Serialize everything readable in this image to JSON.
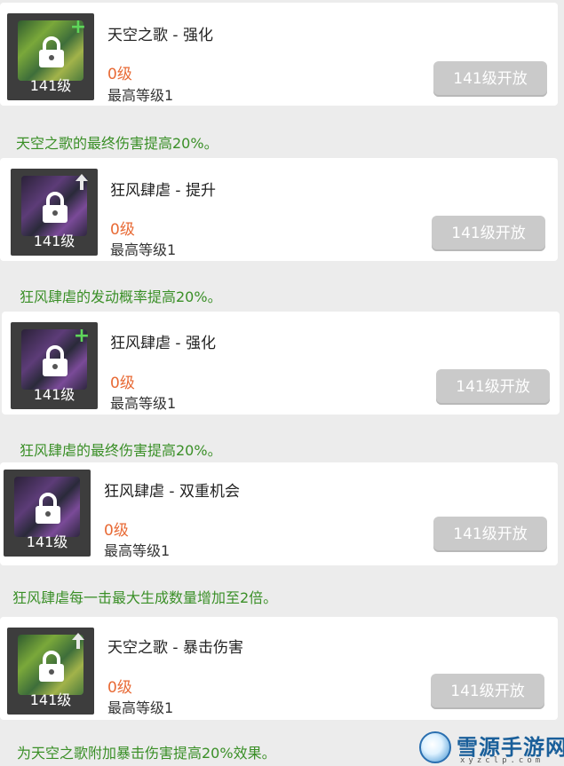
{
  "skills": [
    {
      "title": "天空之歌 - 强化",
      "icon_level": "141级",
      "current_level": "0级",
      "max_level": "最高等级1",
      "button_label": "141级开放",
      "description": "天空之歌的最终伤害提高20%。",
      "icon_badge": "plus-icon",
      "icon_theme": "green"
    },
    {
      "title": "狂风肆虐 - 提升",
      "icon_level": "141级",
      "current_level": "0级",
      "max_level": "最高等级1",
      "button_label": "141级开放",
      "description": "狂风肆虐的发动概率提高20%。",
      "icon_badge": "arrow-up-icon",
      "icon_theme": "purple"
    },
    {
      "title": "狂风肆虐 - 强化",
      "icon_level": "141级",
      "current_level": "0级",
      "max_level": "最高等级1",
      "button_label": "141级开放",
      "description": "狂风肆虐的最终伤害提高20%。",
      "icon_badge": "plus-icon",
      "icon_theme": "purple"
    },
    {
      "title": "狂风肆虐 - 双重机会",
      "icon_level": "141级",
      "current_level": "0级",
      "max_level": "最高等级1",
      "button_label": "141级开放",
      "description": "狂风肆虐每一击最大生成数量增加至2倍。",
      "icon_badge": "none",
      "icon_theme": "purple"
    },
    {
      "title": "天空之歌 - 暴击伤害",
      "icon_level": "141级",
      "current_level": "0级",
      "max_level": "最高等级1",
      "button_label": "141级开放",
      "description": "为天空之歌附加暴击伤害提高20%效果。",
      "icon_badge": "arrow-up-icon",
      "icon_theme": "green"
    }
  ],
  "watermark": {
    "title": "雪源手游网",
    "subtitle": "xyzclp.com"
  },
  "colors": {
    "page_background": "#ececec",
    "card_background": "#ffffff",
    "level_text": "#e86a35",
    "description_text": "#3a8f27",
    "button_disabled": "#cacaca"
  }
}
